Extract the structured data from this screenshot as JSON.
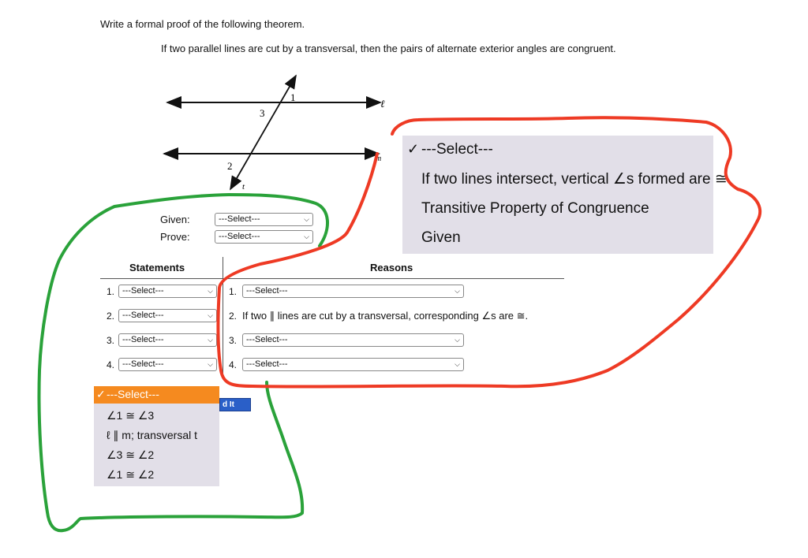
{
  "prompt": "Write a formal proof of the following theorem.",
  "theorem": "If two parallel lines are cut by a transversal, then the pairs of alternate exterior angles are congruent.",
  "diagram": {
    "labels": {
      "angle1": "1",
      "angle2": "2",
      "angle3": "3",
      "line_l": "ℓ",
      "line_m": "m",
      "line_t": "t"
    }
  },
  "given_label": "Given:",
  "prove_label": "Prove:",
  "given_select": "---Select---",
  "prove_select": "---Select---",
  "table": {
    "statements_header": "Statements",
    "reasons_header": "Reasons",
    "rows": [
      {
        "num": "1.",
        "statement": "---Select---",
        "reason_num": "1.",
        "reason": "---Select---"
      },
      {
        "num": "2.",
        "statement": "---Select---",
        "reason_num": "2.",
        "reason": "If two ∥ lines are cut by a transversal, corresponding ∠s are ≅."
      },
      {
        "num": "3.",
        "statement": "---Select---",
        "reason_num": "3.",
        "reason": "---Select---"
      },
      {
        "num": "4.",
        "statement": "---Select---",
        "reason_num": "4.",
        "reason": "---Select---"
      }
    ]
  },
  "reason_dropdown": {
    "check": "✓",
    "options": [
      "---Select---",
      "If two lines intersect, vertical ∠s formed are ≅.",
      "Transitive Property of Congruence",
      "Given"
    ]
  },
  "statement_dropdown": {
    "check": "✓",
    "options": [
      "---Select---",
      "∠1 ≅ ∠3",
      "ℓ ∥ m; transversal t",
      "∠3 ≅ ∠2",
      "∠1 ≅ ∠2"
    ]
  },
  "button_fragment": "d It",
  "colors": {
    "highlight": "#f58a1f",
    "popup_bg": "#e2dfe8",
    "annotation_green": "#2aa23a",
    "annotation_red": "#ee3a24"
  }
}
